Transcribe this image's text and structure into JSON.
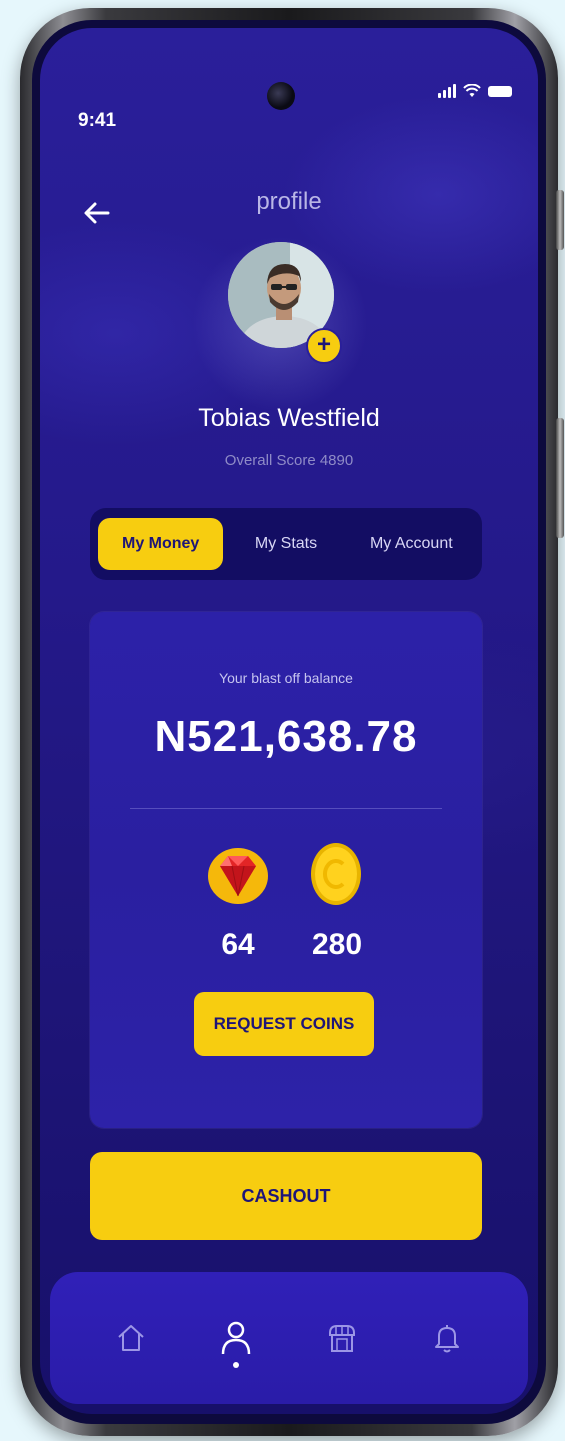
{
  "status_bar": {
    "time": "9:41"
  },
  "header": {
    "title": "profile",
    "back_icon": "arrow-left-icon"
  },
  "profile": {
    "name": "Tobias Westfield",
    "score_text": "Overall Score 4890",
    "add_photo_label": "+"
  },
  "tabs": [
    {
      "label": "My Money",
      "active": true
    },
    {
      "label": "My Stats",
      "active": false
    },
    {
      "label": "My Account",
      "active": false
    }
  ],
  "balance": {
    "label": "Your blast off balance",
    "amount": "N521,638.78",
    "gems": "64",
    "coins": "280",
    "request_button": "REQUEST COINS"
  },
  "cashout": {
    "label": "CASHOUT"
  },
  "bottom_nav": [
    {
      "icon": "home-icon",
      "active": false
    },
    {
      "icon": "profile-icon",
      "active": true
    },
    {
      "icon": "store-icon",
      "active": false
    },
    {
      "icon": "bell-icon",
      "active": false
    }
  ],
  "colors": {
    "accent": "#f7cd10",
    "background": "#2a1f9a",
    "card": "#2c21a8",
    "text_on_accent": "#1e1578"
  }
}
